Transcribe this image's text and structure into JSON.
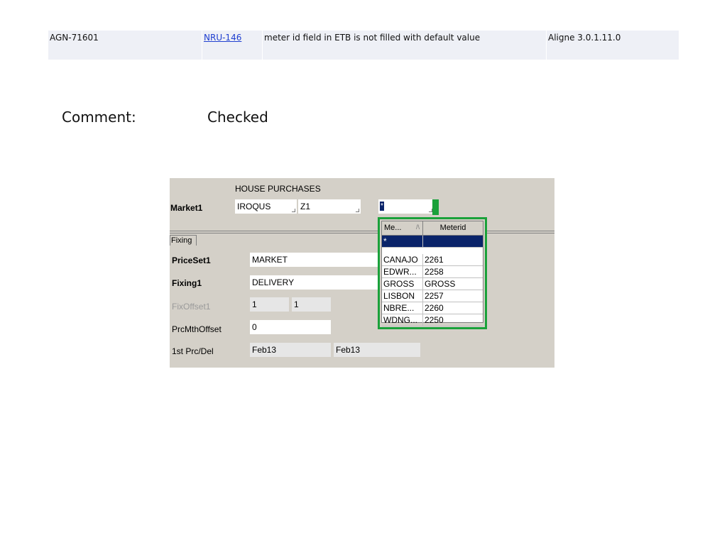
{
  "issue": {
    "id": "AGN-71601",
    "link": "NRU-146",
    "summary": "meter id field in ETB is not filled with default value",
    "version": "Aligne 3.0.1.11.0"
  },
  "comment": {
    "label": "Comment:",
    "value": "Checked"
  },
  "screenshot": {
    "title": "HOUSE PURCHASES",
    "market_label": "Market1",
    "market_value": "IROQUS",
    "zone_value": "Z1",
    "meter_value": "*",
    "tab_label": "Fixing",
    "fields": {
      "priceset_label": "PriceSet1",
      "priceset_value": "MARKET",
      "fixing_label": "Fixing1",
      "fixing_value": "DELIVERY",
      "fixoffset_label": "FixOffset1",
      "fixoffset_a": "1",
      "fixoffset_b": "1",
      "prcmth_label": "PrcMthOffset",
      "prcmth_value": "0",
      "firstprc_label": "1st Prc/Del",
      "firstprc_a": "Feb13",
      "firstprc_b": "Feb13"
    },
    "dropdown": {
      "col1": "Me...",
      "col2": "Meterid",
      "rows": [
        {
          "a": "*",
          "b": ""
        },
        {
          "a": "CANAJO",
          "b": "2261"
        },
        {
          "a": "EDWR...",
          "b": "2258"
        },
        {
          "a": "GROSS",
          "b": "GROSS"
        },
        {
          "a": "LISBON",
          "b": "2257"
        },
        {
          "a": "NBRE...",
          "b": "2260"
        },
        {
          "a": "WDNG...",
          "b": "2250"
        }
      ]
    }
  }
}
